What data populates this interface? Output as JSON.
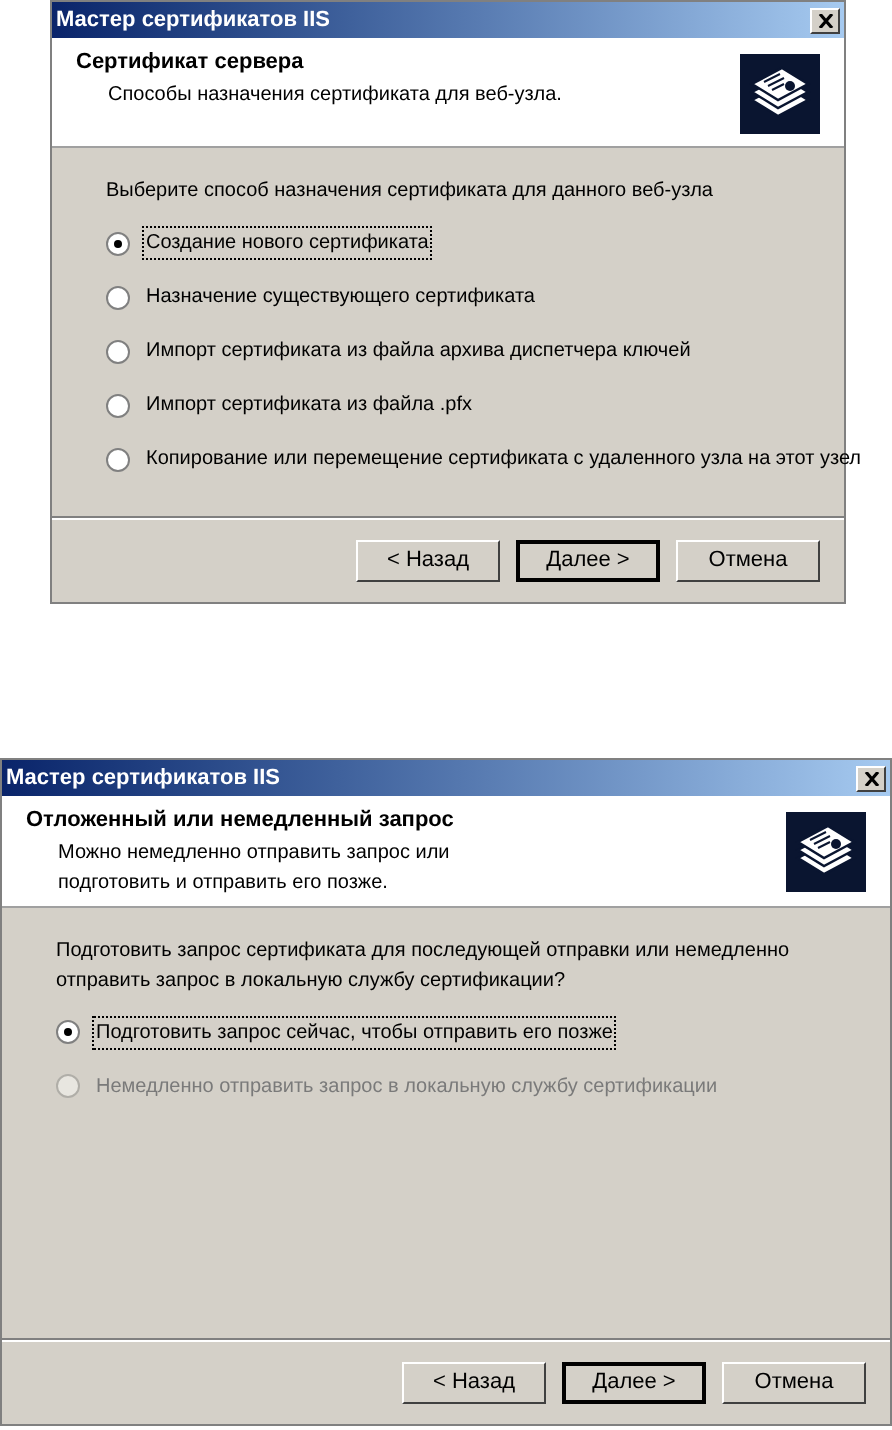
{
  "dialogs": [
    {
      "title": "Мастер сертификатов IIS",
      "header": {
        "title": "Сертификат сервера",
        "subtitle": "Способы назначения сертификата для веб-узла."
      },
      "prompt": "Выберите способ назначения сертификата для данного веб-узла",
      "options": [
        {
          "label": "Создание нового сертификата",
          "selected": true,
          "disabled": false
        },
        {
          "label": "Назначение существующего сертификата",
          "selected": false,
          "disabled": false
        },
        {
          "label": "Импорт сертификата из файла архива диспетчера ключей",
          "selected": false,
          "disabled": false
        },
        {
          "label": "Импорт сертификата из файла .pfx",
          "selected": false,
          "disabled": false
        },
        {
          "label": "Копирование или перемещение сертификата с удаленного узла на этот узел",
          "selected": false,
          "disabled": false
        }
      ],
      "buttons": [
        {
          "label": "< Назад",
          "default": false
        },
        {
          "label": "Далее >",
          "default": true
        },
        {
          "label": "Отмена",
          "default": false
        }
      ]
    },
    {
      "title": "Мастер сертификатов IIS",
      "header": {
        "title": "Отложенный или немедленный запрос",
        "subtitle": "Можно немедленно отправить запрос или подготовить и отправить его позже."
      },
      "prompt": "Подготовить запрос сертификата для последующей отправки или немедленно отправить запрос в локальную службу сертификации?",
      "options": [
        {
          "label": "Подготовить запрос сейчас, чтобы отправить его позже",
          "selected": true,
          "disabled": false
        },
        {
          "label": "Немедленно отправить запрос в локальную службу сертификации",
          "selected": false,
          "disabled": true
        }
      ],
      "buttons": [
        {
          "label": "< Назад",
          "default": false
        },
        {
          "label": "Далее >",
          "default": true
        },
        {
          "label": "Отмена",
          "default": false
        }
      ]
    }
  ]
}
